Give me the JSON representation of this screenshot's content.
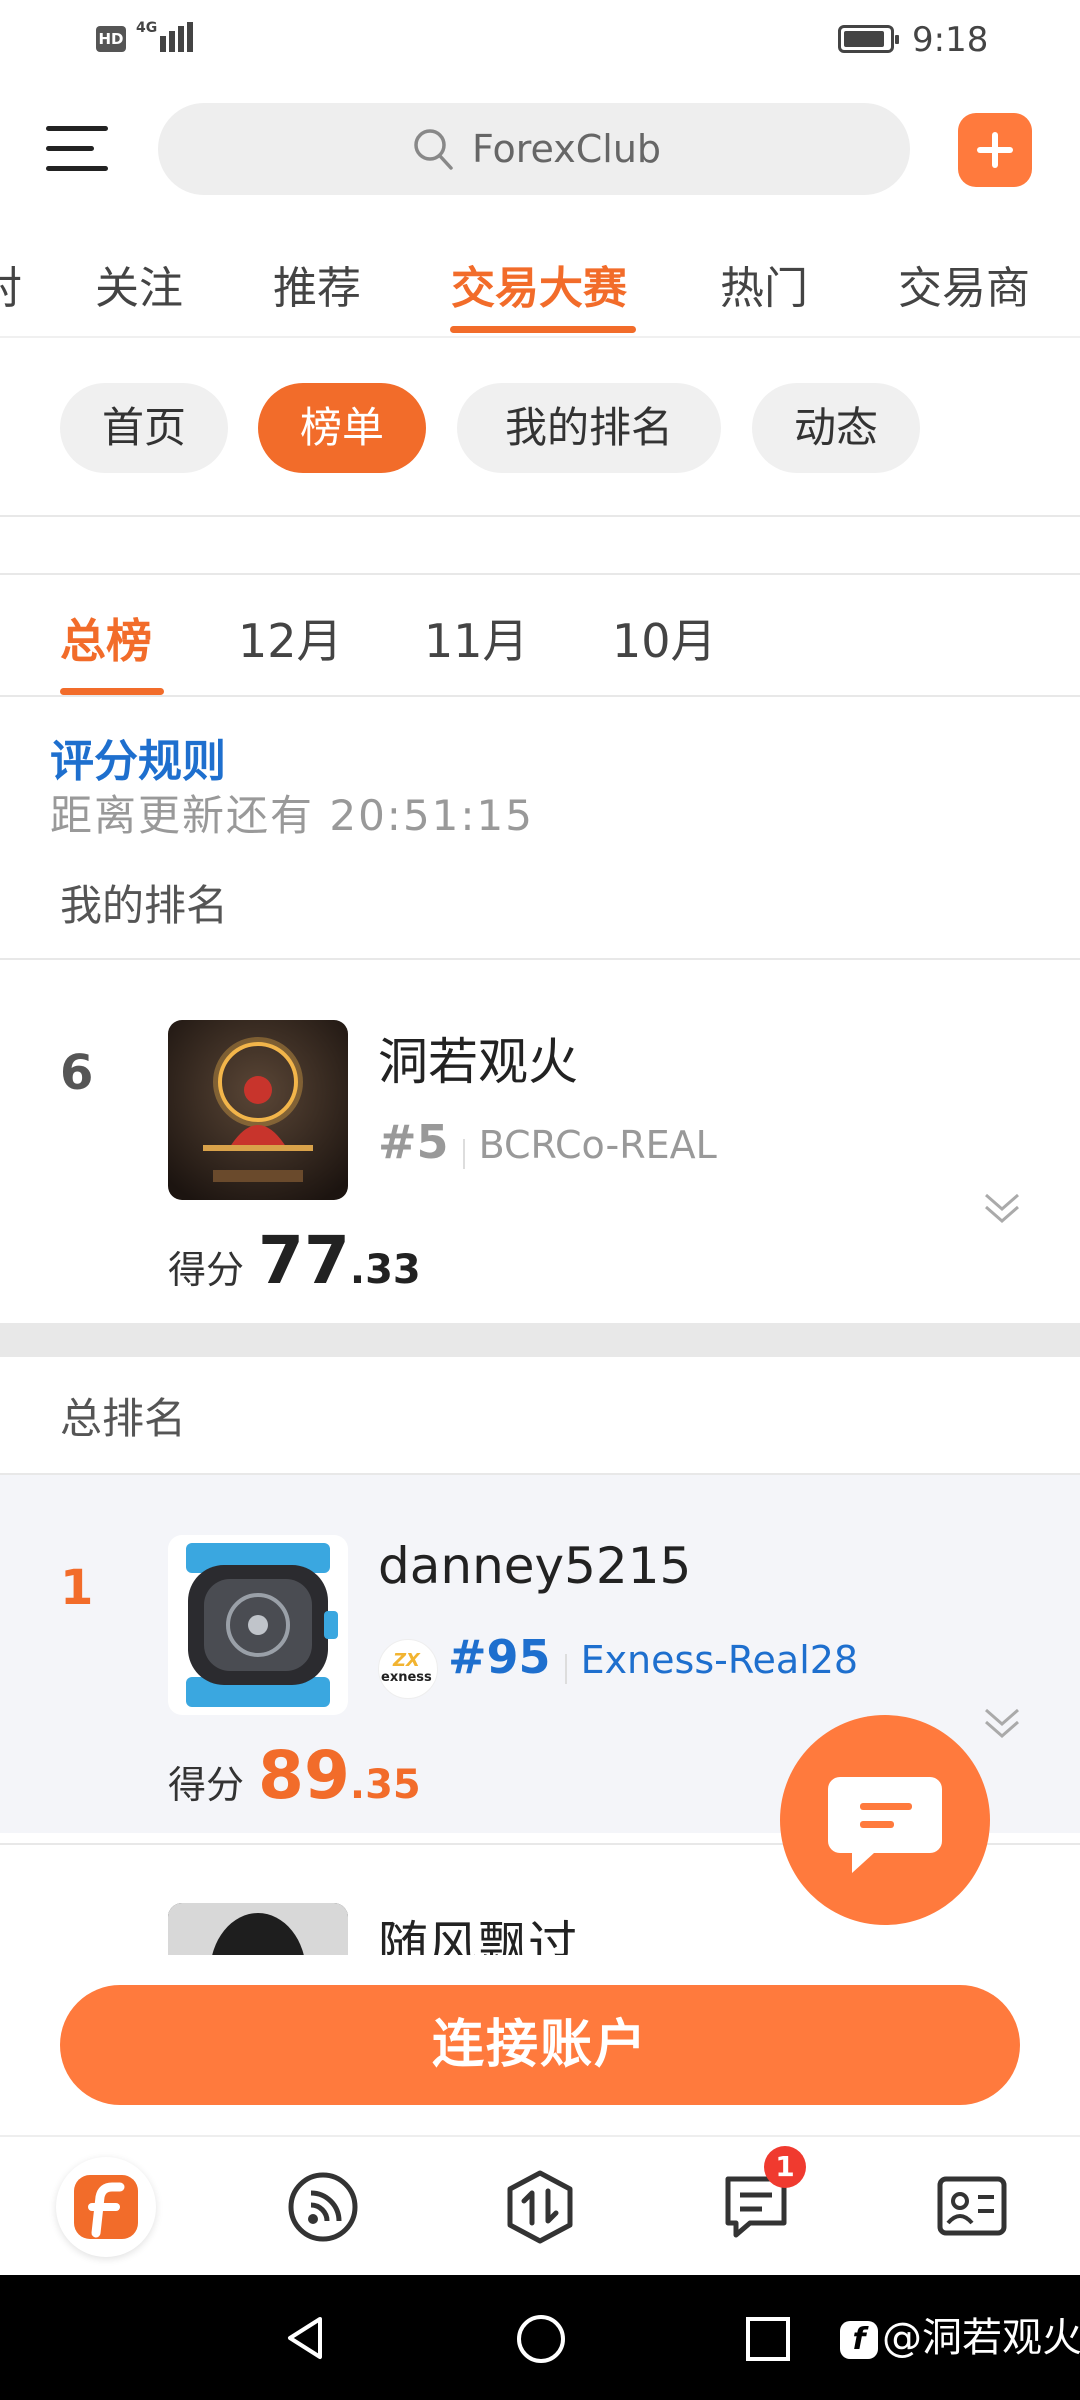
{
  "status_bar": {
    "hd": "HD",
    "network": "4G",
    "time": "9:18"
  },
  "header": {
    "search_placeholder": "ForexClub"
  },
  "top_nav": [
    "关注",
    "推荐",
    "交易大赛",
    "热门",
    "交易商"
  ],
  "sub_tabs": [
    "首页",
    "榜单",
    "我的排名",
    "动态"
  ],
  "period_tabs": [
    "总榜",
    "12月",
    "11月",
    "10月"
  ],
  "rules_link": "评分规则",
  "countdown": "距离更新还有 20:51:15",
  "my_rank_label": "我的排名",
  "overall_rank_label": "总排名",
  "my_entry": {
    "rank": "6",
    "name": "洞若观火",
    "trader_rank": "#5",
    "account": "BCRCo-REAL",
    "score_label": "得分",
    "score_int": "77",
    "score_dec": ".33"
  },
  "entries": [
    {
      "rank": "1",
      "name": "danney5215",
      "broker_logo": "exness",
      "trader_rank": "#95",
      "account": "Exness-Real28",
      "score_label": "得分",
      "score_int": "89",
      "score_dec": ".35"
    },
    {
      "name": "随风飘过"
    }
  ],
  "connect_button": "连接账户",
  "messages_badge": "1",
  "watermark": "@洞若观火",
  "colors": {
    "accent": "#f26c2a",
    "fab": "#ff7a3d",
    "link": "#1e6fce"
  }
}
